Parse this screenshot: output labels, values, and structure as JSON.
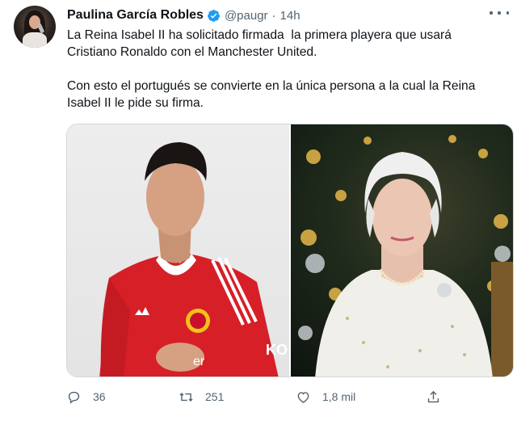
{
  "tweet": {
    "author_name": "Paulina García Robles",
    "handle": "@paugr",
    "separator": "·",
    "time": "14h",
    "paragraphs": [
      "La Reina Isabel II ha solicitado firmada  la primera playera que usará Cristiano Ronaldo con el Manchester United.",
      "Con esto el portugués se convierte en la única persona a la cual la Reina Isabel II le pide su firma."
    ],
    "jersey_text_left": "KO",
    "jersey_sponsor": "er",
    "actions": {
      "reply_count": "36",
      "retweet_count": "251",
      "like_count": "1,8 mil"
    }
  },
  "colors": {
    "verified_blue": "#1d9bf0",
    "muted_text": "#536471",
    "jersey_red": "#da2027"
  },
  "icons": {
    "verified": "verified-badge-icon",
    "more": "more-options-icon",
    "reply": "reply-icon",
    "retweet": "retweet-icon",
    "like": "like-icon",
    "share": "share-icon"
  }
}
